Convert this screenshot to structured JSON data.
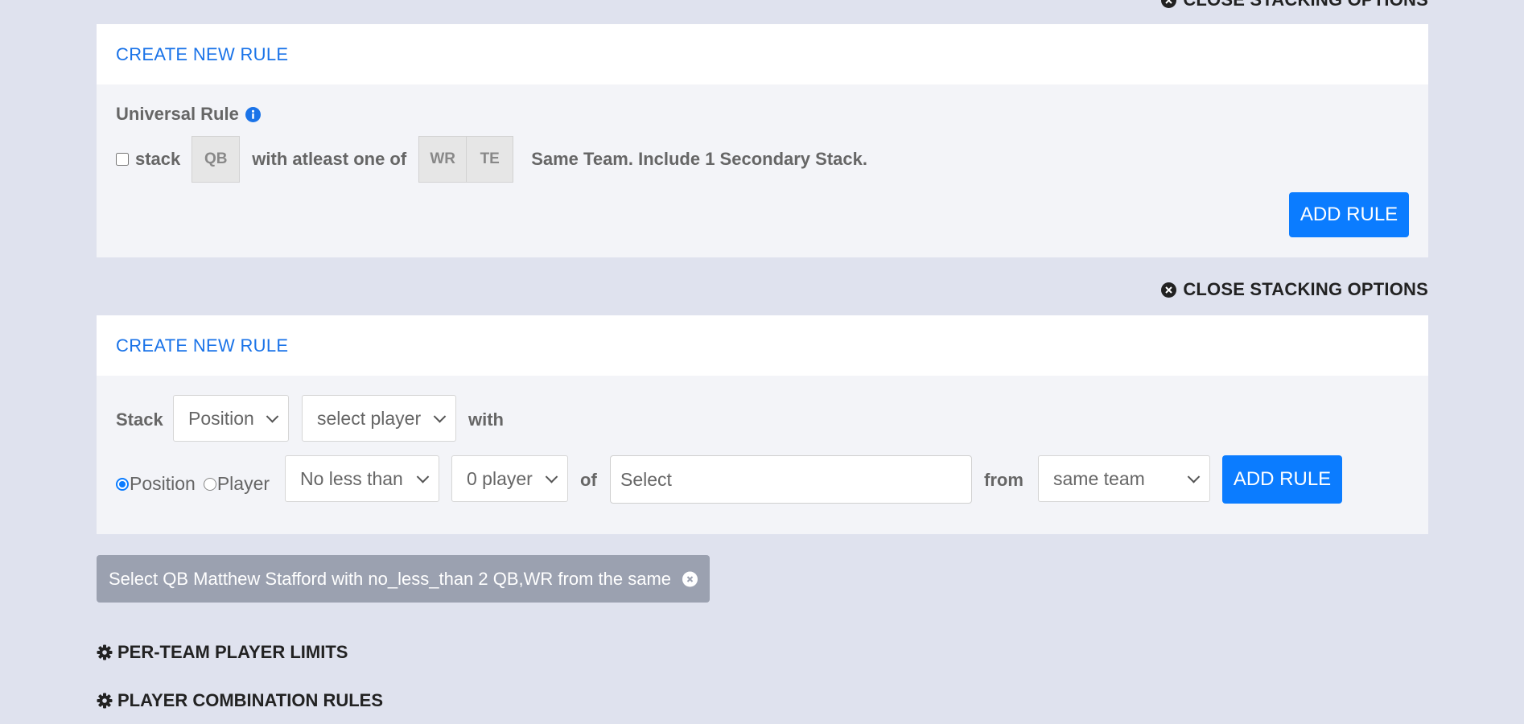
{
  "top_close": {
    "label": "CLOSE STACKING OPTIONS"
  },
  "universal_panel": {
    "header": "CREATE NEW RULE",
    "universal_rule_label": "Universal Rule",
    "stack_label": "stack",
    "stack_position": "QB",
    "with_label": "with atleast one of",
    "with_positions": [
      "WR",
      "TE"
    ],
    "suffix_text": "Same Team. Include 1 Secondary Stack.",
    "add_rule": "ADD RULE"
  },
  "mid_close": {
    "label": "CLOSE STACKING OPTIONS"
  },
  "custom_panel": {
    "header": "CREATE NEW RULE",
    "stack_label": "Stack",
    "stack_type_value": "Position",
    "player_select_value": "select player",
    "with_label": "with",
    "radio_position": "Position",
    "radio_player": "Player",
    "comparison_value": "No less than",
    "count_value": "0 player",
    "of_label": "of",
    "target_placeholder": "Select",
    "from_label": "from",
    "team_value": "same team",
    "add_rule": "ADD RULE"
  },
  "rule_tag": {
    "text": "Select QB Matthew Stafford with no_less_than 2 QB,WR from the same"
  },
  "sections": {
    "per_team": "PER-TEAM PLAYER LIMITS",
    "combination": "PLAYER COMBINATION RULES"
  }
}
